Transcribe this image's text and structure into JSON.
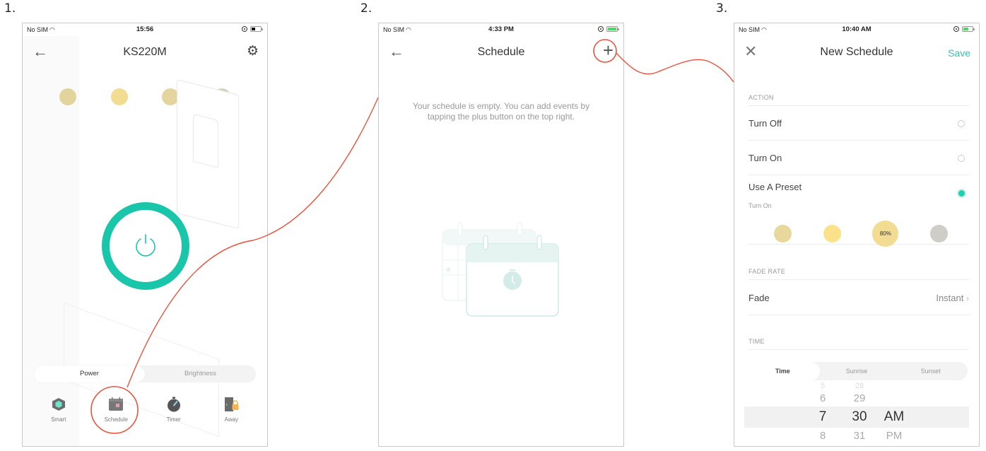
{
  "steps": [
    "1.",
    "2.",
    "3."
  ],
  "accent_color": "#1ac6aa",
  "annotation_color": "#e8553f",
  "phone1": {
    "status": {
      "carrier": "No SIM",
      "time": "15:56"
    },
    "title": "KS220M",
    "back_icon": "arrow-left-icon",
    "settings_icon": "gear-icon",
    "presets": [
      {
        "color": "#e3d49c"
      },
      {
        "color": "#f1dc92"
      },
      {
        "color": "#e4d49e"
      },
      {
        "color": "#d6d1b8"
      }
    ],
    "power_state": "on",
    "segments": [
      {
        "label": "Power",
        "active": true
      },
      {
        "label": "Brightness",
        "active": false
      }
    ],
    "tabs": [
      {
        "label": "Smart",
        "icon": "smart-cube-icon"
      },
      {
        "label": "Schedule",
        "icon": "calendar-icon",
        "highlighted": true
      },
      {
        "label": "Timer",
        "icon": "stopwatch-icon"
      },
      {
        "label": "Away",
        "icon": "away-door-lock-icon"
      }
    ]
  },
  "phone2": {
    "status": {
      "carrier": "No SIM",
      "time": "4:33 PM"
    },
    "title": "Schedule",
    "add_icon": "plus-icon",
    "empty_message": "Your schedule is empty. You can add events by tapping the plus button on the top right."
  },
  "phone3": {
    "status": {
      "carrier": "No SIM",
      "time": "10:40 AM"
    },
    "title": "New Schedule",
    "save_label": "Save",
    "close_icon": "close-x-icon",
    "action_header": "ACTION",
    "actions": [
      {
        "label": "Turn Off",
        "selected": false
      },
      {
        "label": "Turn On",
        "selected": false
      },
      {
        "label": "Use A Preset",
        "sublabel": "Turn On",
        "selected": true
      }
    ],
    "presets": [
      {
        "color": "#e8d89b",
        "label": ""
      },
      {
        "color": "#fbe28a",
        "label": ""
      },
      {
        "color": "#f2dc91",
        "label": "80%",
        "selected": true
      },
      {
        "color": "#cfcdc8",
        "label": ""
      }
    ],
    "fade_header": "FADE RATE",
    "fade_label": "Fade",
    "fade_value": "Instant",
    "time_header": "TIME",
    "time_modes": [
      {
        "label": "Time",
        "active": true
      },
      {
        "label": "Sunrise",
        "active": false
      },
      {
        "label": "Sunset",
        "active": false
      }
    ],
    "picker": {
      "hours": [
        "5",
        "6",
        "7",
        "8"
      ],
      "minutes": [
        "28",
        "29",
        "30",
        "31"
      ],
      "ampm": [
        "AM",
        "PM"
      ],
      "selected": {
        "hour": "7",
        "minute": "30",
        "ampm": "AM"
      }
    }
  }
}
